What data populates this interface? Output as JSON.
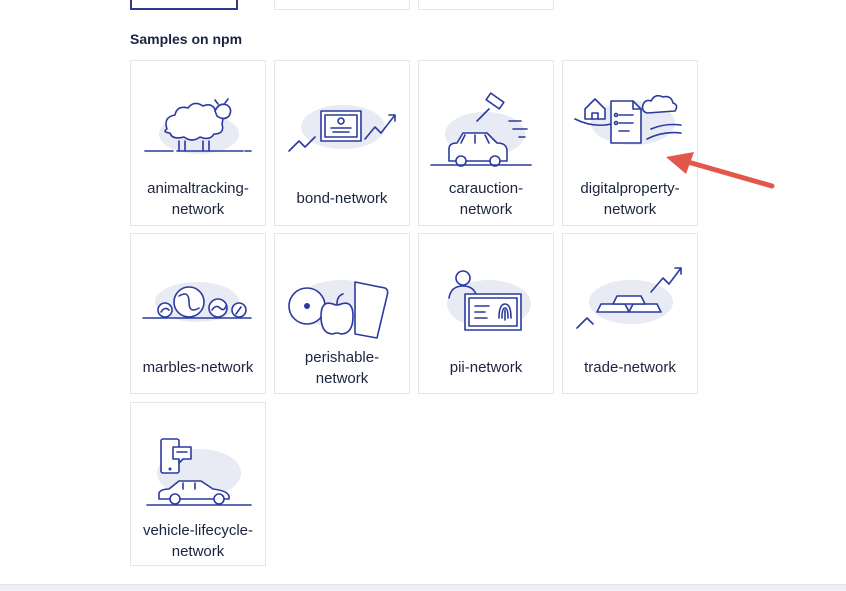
{
  "section_title": "Samples on npm",
  "samples": [
    {
      "label": "animaltracking-\nnetwork",
      "icon": "sheep-icon"
    },
    {
      "label": "bond-network",
      "icon": "bond-certificate-icon"
    },
    {
      "label": "carauction-\nnetwork",
      "icon": "car-auction-icon"
    },
    {
      "label": "digitalproperty-\nnetwork",
      "icon": "property-document-icon"
    },
    {
      "label": "marbles-network",
      "icon": "marbles-icon"
    },
    {
      "label": "perishable-\nnetwork",
      "icon": "perishable-food-icon"
    },
    {
      "label": "pii-network",
      "icon": "fingerprint-id-icon"
    },
    {
      "label": "trade-network",
      "icon": "gold-bars-icon"
    },
    {
      "label": "vehicle-lifecycle-\nnetwork",
      "icon": "vehicle-phone-icon"
    }
  ],
  "colors": {
    "accent": "#2b3aa0",
    "annotation_arrow": "#e2574c"
  }
}
